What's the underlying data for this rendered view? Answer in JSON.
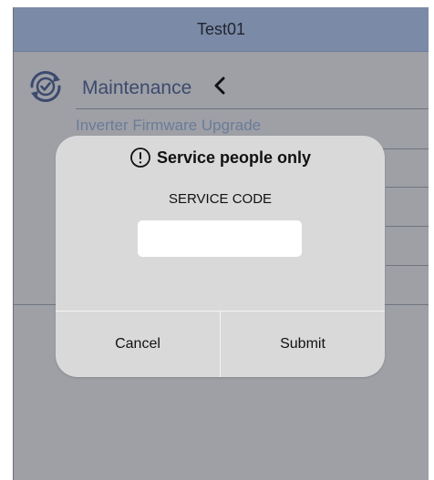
{
  "header": {
    "title": "Test01"
  },
  "section": {
    "icon": "maintenance-check-icon",
    "title": "Maintenance",
    "back_icon": "chevron-left-icon"
  },
  "list": {
    "items": [
      {
        "label": "Inverter Firmware Upgrade"
      }
    ]
  },
  "dialog": {
    "icon": "alert-circle-icon",
    "title": "Service people only",
    "field_label": "SERVICE CODE",
    "input_value": "",
    "cancel_label": "Cancel",
    "submit_label": "Submit"
  },
  "colors": {
    "header_bg": "#7b8aa6",
    "overlay_bg": "#9ea0a6",
    "accent_text": "#3d4a6e",
    "dialog_bg": "#d9d9da"
  }
}
